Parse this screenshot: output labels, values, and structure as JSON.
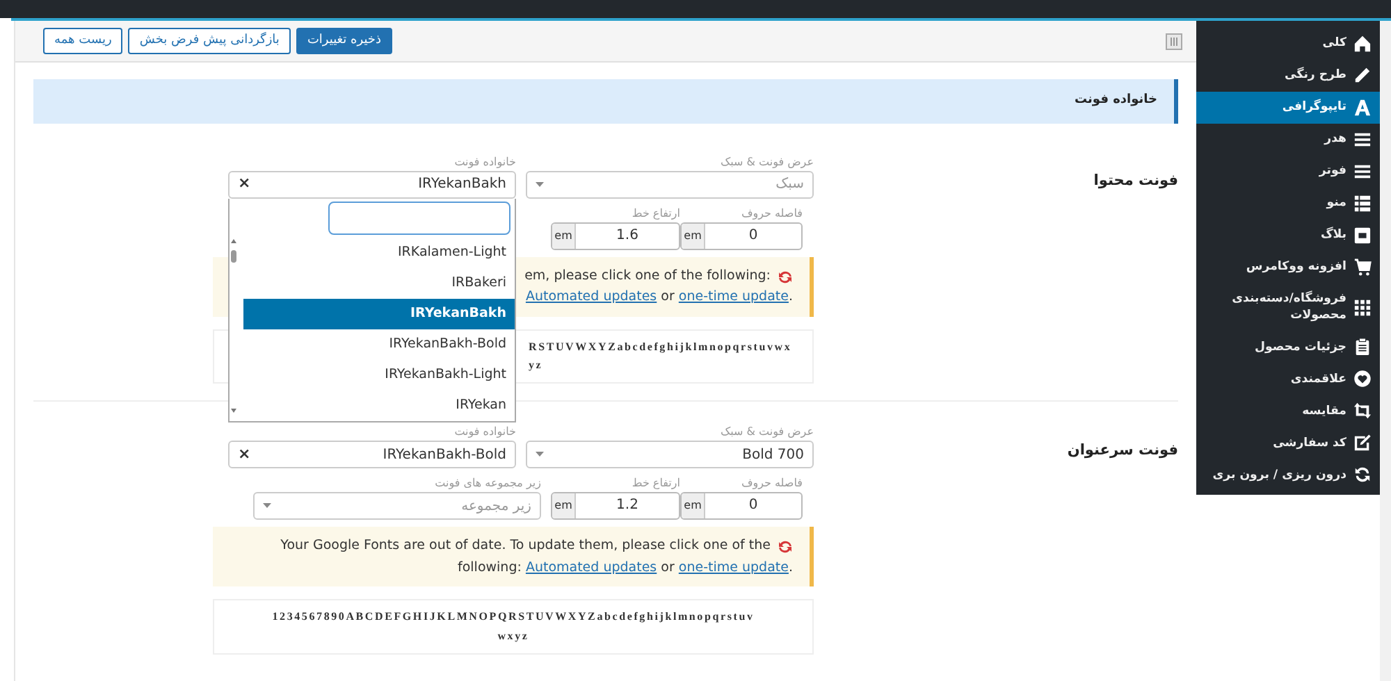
{
  "toolbar": {
    "buttons": [
      {
        "label": "ذخیره تغییرات",
        "kind": "primary"
      },
      {
        "label": "بازگردانی پیش فرض بخش",
        "kind": "secondary"
      },
      {
        "label": "ریست همه",
        "kind": "secondary"
      }
    ]
  },
  "sidebar": {
    "items": [
      {
        "label": "کلی",
        "selected": false
      },
      {
        "label": "طرح رنگی",
        "selected": false
      },
      {
        "label": "تایپوگرافی",
        "selected": true
      },
      {
        "label": "هدر",
        "selected": false
      },
      {
        "label": "فوتر",
        "selected": false
      },
      {
        "label": "منو",
        "selected": false
      },
      {
        "label": "بلاگ",
        "selected": false
      },
      {
        "label": "افزونه ووکامرس",
        "selected": false
      },
      {
        "label": "فروشگاه/دسته‌بندی محصولات",
        "selected": false
      },
      {
        "label": "جزئیات محصول",
        "selected": false
      },
      {
        "label": "علاقمندی",
        "selected": false
      },
      {
        "label": "مقایسه",
        "selected": false
      },
      {
        "label": "کد سفارشی",
        "selected": false
      },
      {
        "label": "درون ریزی / برون بری",
        "selected": false
      }
    ]
  },
  "section_title": "خانواده فونت",
  "settings": [
    {
      "label": "فونت محتوا",
      "font_family": {
        "label": "خانواده فونت",
        "value": "IRYekanBakh",
        "clear": "×",
        "open": true,
        "options": [
          {
            "label": "IRKalamen-Light",
            "selected": false
          },
          {
            "label": "IRBakeri",
            "selected": false
          },
          {
            "label": "IRYekanBakh",
            "selected": true
          },
          {
            "label": "IRYekanBakh-Bold",
            "selected": false
          },
          {
            "label": "IRYekanBakh-Light",
            "selected": false
          },
          {
            "label": "IRYekan",
            "selected": false
          }
        ]
      },
      "font_weight": {
        "label": "عرض فونت & سبک",
        "placeholder": "سبک"
      },
      "line_height": {
        "label": "ارتفاع خط",
        "value": "1.6",
        "unit": "em"
      },
      "letter_spacing": {
        "label": "فاصله حروف",
        "value": "0",
        "unit": "em"
      },
      "notice": {
        "text": "em, please click one of the following: ",
        "automated_link": "Automated updates",
        "separator": " or ",
        "one_time_link": "one-time update",
        "ending": "."
      },
      "preview": {
        "lines": [
          "RSTUVWXYZabcdefghijklmnopqrstuvwx",
          "yz"
        ]
      }
    },
    {
      "label": "فونت سرعنوان",
      "font_family": {
        "label": "خانواده فونت",
        "value": "IRYekanBakh-Bold",
        "clear": "×",
        "open": false
      },
      "font_weight": {
        "label": "عرض فونت & سبک",
        "value": "Bold 700"
      },
      "subsets": {
        "label": "زیر مجموعه های فونت",
        "placeholder": "زیر مجموعه"
      },
      "line_height": {
        "label": "ارتفاع خط",
        "value": "1.2",
        "unit": "em"
      },
      "letter_spacing": {
        "label": "فاصله حروف",
        "value": "0",
        "unit": "em"
      },
      "notice": {
        "text": "Your Google Fonts are out of date. To update them, please click one of the following: ",
        "automated_link": "Automated updates",
        "separator": " or ",
        "one_time_link": "one-time update",
        "ending": "."
      },
      "preview": {
        "lines": [
          "1234567890ABCDEFGHIJKLMNOPQRSTUVWXYZabcdefghijklmnopqrstuv",
          "wxyz"
        ]
      }
    }
  ]
}
